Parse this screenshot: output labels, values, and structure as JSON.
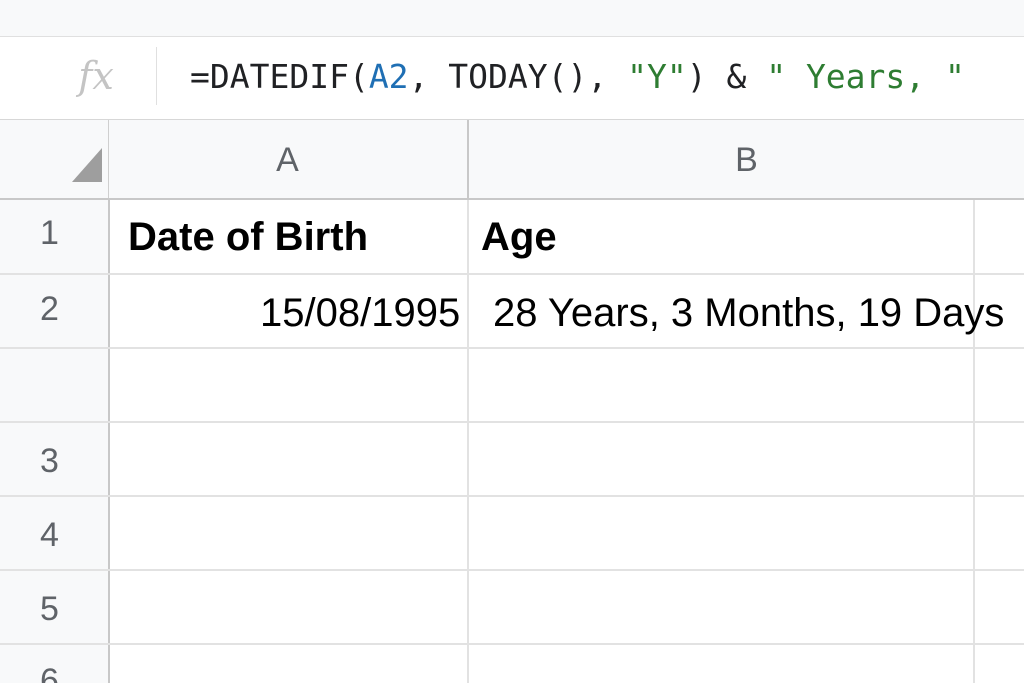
{
  "formula_bar": {
    "fx_label": "fx",
    "formula_parts": [
      {
        "text": "=DATEDIF(",
        "kind": "plain"
      },
      {
        "text": "A2",
        "kind": "ref"
      },
      {
        "text": ", TODAY(), ",
        "kind": "plain"
      },
      {
        "text": "\"Y\"",
        "kind": "string"
      },
      {
        "text": ") & ",
        "kind": "plain"
      },
      {
        "text": "\" Years, \"",
        "kind": "string"
      }
    ]
  },
  "columns": [
    "A",
    "B"
  ],
  "rows": [
    "1",
    "2",
    "",
    "3",
    "4",
    "5",
    "6"
  ],
  "cells": {
    "A1": "Date of Birth",
    "B1": "Age",
    "A2": "15/08/1995",
    "B2": "28 Years, 3 Months, 19 Days"
  },
  "colors": {
    "reference": "#1f6fb4",
    "string": "#2e7d32",
    "header_bg": "#f8f9fa",
    "grid": "#e2e2e2"
  }
}
